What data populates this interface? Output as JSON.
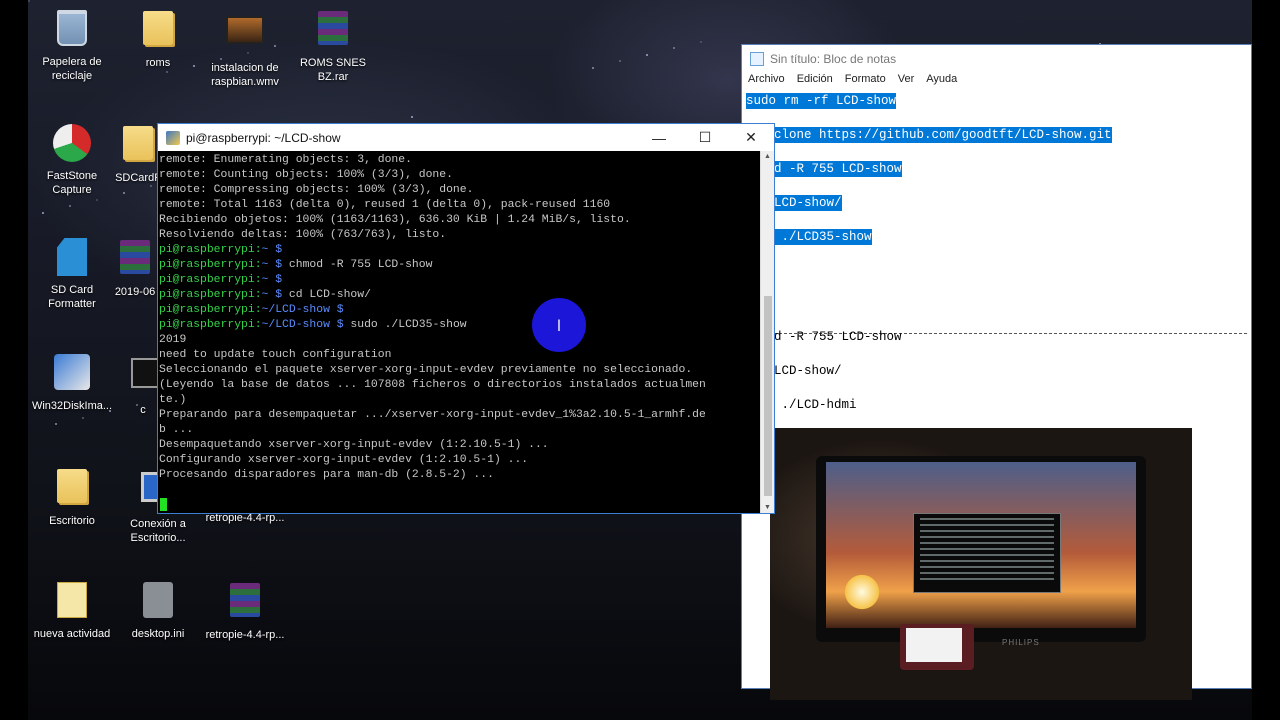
{
  "desktop_icons": {
    "recycle": "Papelera de reciclaje",
    "roms": "roms",
    "instalacion": "instalacion de raspbian.wmv",
    "roms_snes": "ROMS SNES BZ.rar",
    "faststone": "FastStone Capture",
    "sdcardf": "SDCardF",
    "sdformatter": "SD Card Formatter",
    "folder_2019": "2019-06",
    "win32": "Win32DiskIma...",
    "cmd_item": "c",
    "escritorio": "Escritorio",
    "conexion": "Conexión a Escritorio...",
    "retropie1": "retropie-4.4-rp...",
    "nueva": "nueva actividad",
    "desktopini": "desktop.ini",
    "retropie2": "retropie-4.4-rp..."
  },
  "putty": {
    "title": "pi@raspberrypi: ~/LCD-show",
    "lines": [
      {
        "t": "remote: Enumerating objects: 3, done."
      },
      {
        "t": "remote: Counting objects: 100% (3/3), done."
      },
      {
        "t": "remote: Compressing objects: 100% (3/3), done."
      },
      {
        "t": "remote: Total 1163 (delta 0), reused 1 (delta 0), pack-reused 1160"
      },
      {
        "t": "Recibiendo objetos: 100% (1163/1163), 636.30 KiB | 1.24 MiB/s, listo."
      },
      {
        "t": "Resolviendo deltas: 100% (763/763), listo."
      },
      {
        "user": "pi@raspberrypi",
        "path": "~ $",
        "cmd": ""
      },
      {
        "user": "pi@raspberrypi",
        "path": "~ $",
        "cmd": " chmod -R 755 LCD-show"
      },
      {
        "user": "pi@raspberrypi",
        "path": "~ $",
        "cmd": ""
      },
      {
        "user": "pi@raspberrypi",
        "path": "~ $",
        "cmd": " cd LCD-show/"
      },
      {
        "user": "pi@raspberrypi",
        "path": "~/LCD-show $",
        "cmd": ""
      },
      {
        "user": "pi@raspberrypi",
        "path": "~/LCD-show $",
        "cmd": " sudo ./LCD35-show"
      },
      {
        "t": "2019"
      },
      {
        "t": "need to update touch configuration"
      },
      {
        "t": "Seleccionando el paquete xserver-xorg-input-evdev previamente no seleccionado."
      },
      {
        "t": "(Leyendo la base de datos ... 107808 ficheros o directorios instalados actualmen"
      },
      {
        "t": "te.)"
      },
      {
        "t": "Preparando para desempaquetar .../xserver-xorg-input-evdev_1%3a2.10.5-1_armhf.de"
      },
      {
        "t": "b ..."
      },
      {
        "t": "Desempaquetando xserver-xorg-input-evdev (1:2.10.5-1) ..."
      },
      {
        "t": "Configurando xserver-xorg-input-evdev (1:2.10.5-1) ..."
      },
      {
        "t": "Procesando disparadores para man-db (2.8.5-2) ..."
      }
    ],
    "minimize": "—",
    "maximize": "☐",
    "close": "✕"
  },
  "notepad": {
    "title": "Sin título: Bloc de notas",
    "menu": [
      "Archivo",
      "Edición",
      "Formato",
      "Ver",
      "Ayuda"
    ],
    "selected_lines": [
      "sudo rm -rf LCD-show",
      "clone https://github.com/goodtft/LCD-show.git",
      "d -R 755 LCD-show",
      "LCD-show/",
      " ./LCD35-show"
    ],
    "lower_lines": [
      "d -R 755 LCD-show",
      "LCD-show/",
      " ./LCD-hdmi"
    ]
  },
  "photo": {
    "brand": "PHILIPS"
  },
  "cursor_glyph": "I"
}
